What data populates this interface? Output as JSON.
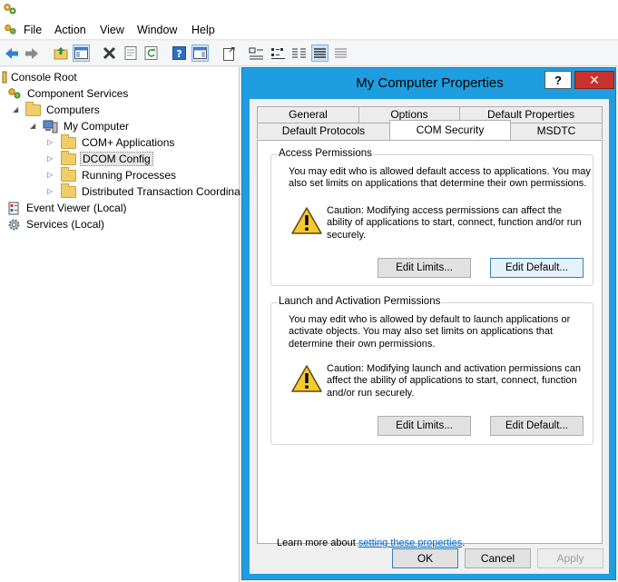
{
  "menu": {
    "items": [
      "File",
      "Action",
      "View",
      "Window",
      "Help"
    ]
  },
  "toolbar": {
    "icons": [
      "back-arrow-icon",
      "forward-arrow-icon",
      "up-folder-icon",
      "show-hide-tree-icon",
      "delete-icon",
      "properties-icon",
      "refresh-icon",
      "help-icon",
      "show-hide-action-pane-icon",
      "export-list-icon",
      "large-icons-view-icon",
      "small-icons-view-icon",
      "list-view-icon",
      "detail-view-icon",
      "column-view-icon"
    ]
  },
  "tree": {
    "nodes": [
      {
        "label": "Console Root",
        "icon": "console-root-icon"
      },
      {
        "label": "Component Services",
        "icon": "component-services-icon"
      },
      {
        "label": "Computers",
        "icon": "folder-icon"
      },
      {
        "label": "My Computer",
        "icon": "computer-icon"
      },
      {
        "label": "COM+ Applications",
        "icon": "folder-icon"
      },
      {
        "label": "DCOM Config",
        "icon": "folder-icon"
      },
      {
        "label": "Running Processes",
        "icon": "folder-icon"
      },
      {
        "label": "Distributed Transaction Coordina",
        "icon": "folder-icon"
      },
      {
        "label": "Event Viewer (Local)",
        "icon": "event-viewer-icon"
      },
      {
        "label": "Services (Local)",
        "icon": "services-gear-icon"
      }
    ]
  },
  "dialog": {
    "title": "My Computer Properties",
    "help_label": "?",
    "close_label": "✕",
    "tabs_row1": [
      "General",
      "Options",
      "Default Properties"
    ],
    "tabs_row2": [
      "Default Protocols",
      "COM Security",
      "MSDTC"
    ],
    "active_tab": "COM Security",
    "access": {
      "legend": "Access Permissions",
      "description": "You may edit who is allowed default access to applications. You may also set limits on applications that determine their own permissions.",
      "caution": "Caution: Modifying access permissions can affect the ability of applications to start, connect, function and/or run securely.",
      "edit_limits": "Edit Limits...",
      "edit_default": "Edit Default..."
    },
    "launch": {
      "legend": "Launch and Activation Permissions",
      "description": "You may edit who is allowed by default to launch applications or activate objects. You may also set limits on applications that determine their own permissions.",
      "caution": "Caution: Modifying launch and activation permissions can affect the ability of applications to start, connect, function and/or run securely.",
      "edit_limits": "Edit Limits...",
      "edit_default": "Edit Default..."
    },
    "learn_more_prefix": "Learn more about ",
    "learn_more_link": "setting these properties",
    "learn_more_suffix": ".",
    "ok": "OK",
    "cancel": "Cancel",
    "apply": "Apply"
  },
  "colors": {
    "dialog_frame": "#1e9ee0",
    "close_button": "#c9312b",
    "link": "#0066cc",
    "selection": "#e5e5e5"
  }
}
